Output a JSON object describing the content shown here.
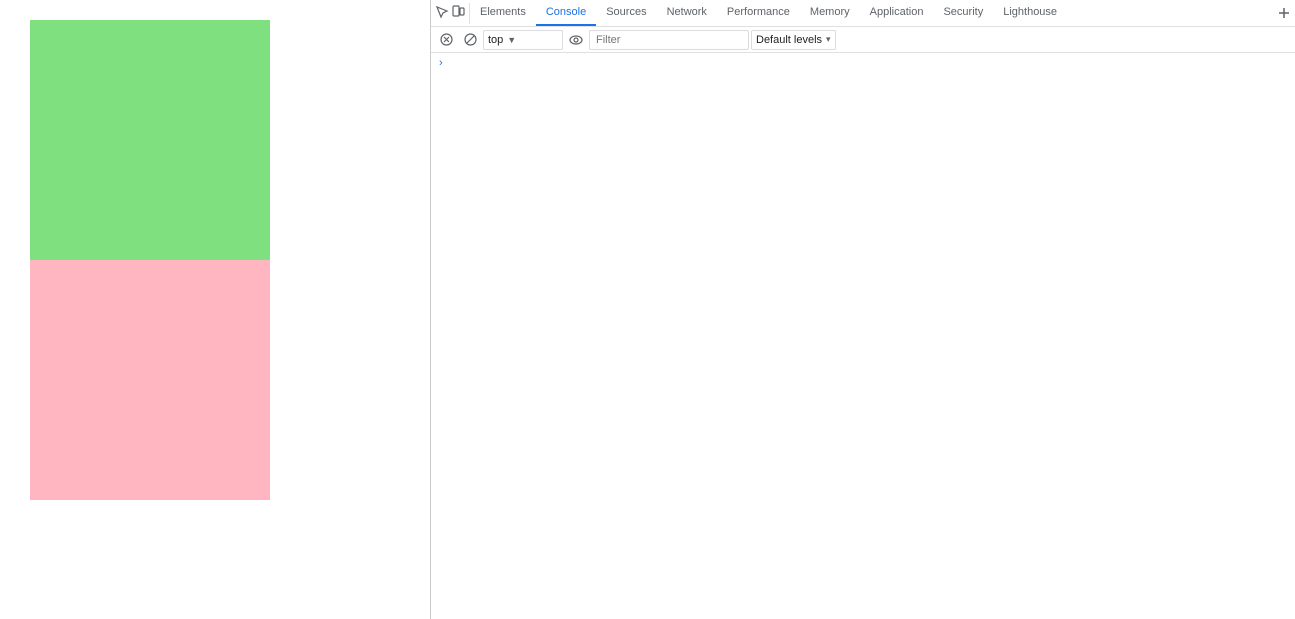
{
  "webpage": {
    "green_box_color": "#7FE07F",
    "pink_box_color": "#FFB6C1"
  },
  "devtools": {
    "tabs": [
      {
        "label": "Elements",
        "active": false
      },
      {
        "label": "Console",
        "active": true
      },
      {
        "label": "Sources",
        "active": false
      },
      {
        "label": "Network",
        "active": false
      },
      {
        "label": "Performance",
        "active": false
      },
      {
        "label": "Memory",
        "active": false
      },
      {
        "label": "Application",
        "active": false
      },
      {
        "label": "Security",
        "active": false
      },
      {
        "label": "Lighthouse",
        "active": false
      }
    ],
    "toolbar": {
      "context_label": "top",
      "filter_placeholder": "Filter",
      "levels_label": "Default levels"
    },
    "console": {
      "prompt_chevron": "›"
    }
  }
}
